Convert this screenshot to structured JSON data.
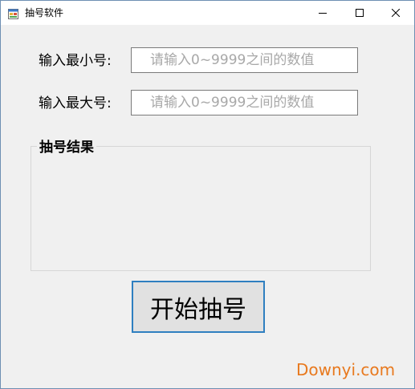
{
  "window": {
    "title": "抽号软件",
    "app_icon": "app-window-icon",
    "controls": {
      "minimize_icon": "minimize-icon",
      "maximize_icon": "maximize-icon",
      "close_icon": "close-icon"
    }
  },
  "form": {
    "min_label": "输入最小号:",
    "min_value": "",
    "min_placeholder": "请输入0~9999之间的数值",
    "max_label": "输入最大号:",
    "max_value": "",
    "max_placeholder": "请输入0~9999之间的数值"
  },
  "result_group": {
    "title": "抽号结果",
    "content": ""
  },
  "actions": {
    "start_label": "开始抽号"
  },
  "watermark": {
    "text": "Downyi.com"
  },
  "colors": {
    "button_border": "#2f7fc0",
    "watermark": "#e8791e",
    "placeholder": "#a8a8a8",
    "window_background": "#f0f0f0"
  }
}
